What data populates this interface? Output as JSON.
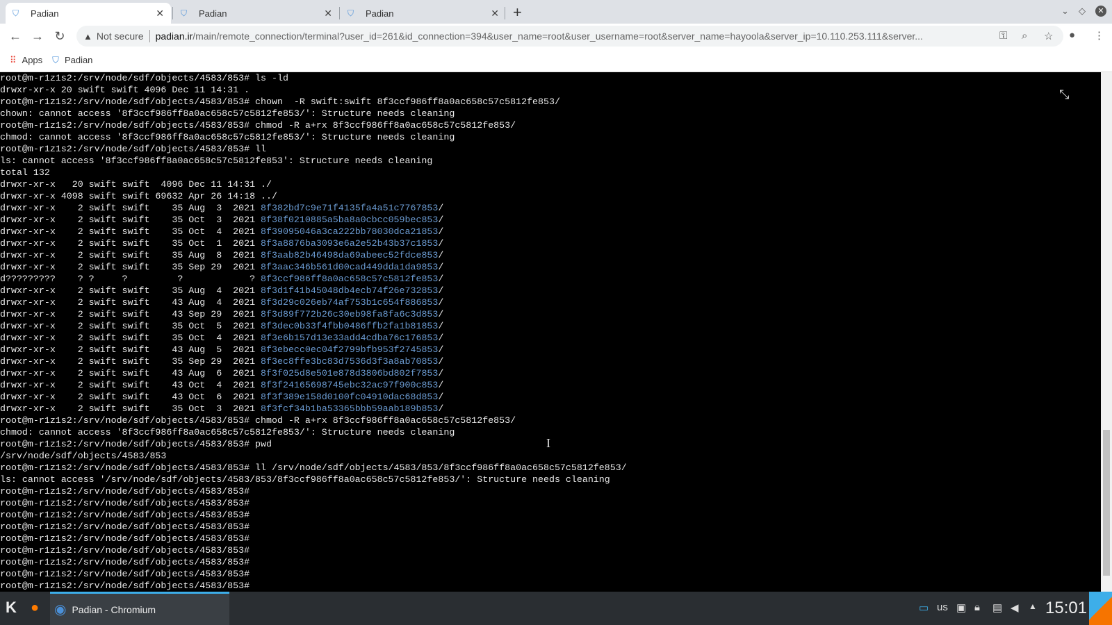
{
  "browser": {
    "tabs": [
      {
        "label": "Padian",
        "active": true
      },
      {
        "label": "Padian",
        "active": false
      },
      {
        "label": "Padian",
        "active": false
      }
    ],
    "security_label": "Not secure",
    "url_host": "padian.ir",
    "url_path": "/main/remote_connection/terminal?user_id=261&id_connection=394&user_name=root&user_username=root&server_name=hayoola&server_ip=10.110.253.111&server...",
    "bookmarks": [
      {
        "label": "Apps"
      },
      {
        "label": "Padian"
      }
    ]
  },
  "terminal": {
    "lines": [
      {
        "t": "root@m-r1z1s2:/srv/node/sdf/objects/4583/853# ls -ld"
      },
      {
        "t": "drwxr-xr-x 20 swift swift 4096 Dec 11 14:31 ."
      },
      {
        "t": "root@m-r1z1s2:/srv/node/sdf/objects/4583/853# chown  -R swift:swift 8f3ccf986ff8a0ac658c57c5812fe853/"
      },
      {
        "t": "chown: cannot access '8f3ccf986ff8a0ac658c57c5812fe853/': Structure needs cleaning"
      },
      {
        "t": "root@m-r1z1s2:/srv/node/sdf/objects/4583/853# chmod -R a+rx 8f3ccf986ff8a0ac658c57c5812fe853/"
      },
      {
        "t": "chmod: cannot access '8f3ccf986ff8a0ac658c57c5812fe853/': Structure needs cleaning"
      },
      {
        "t": "root@m-r1z1s2:/srv/node/sdf/objects/4583/853# ll"
      },
      {
        "t": "ls: cannot access '8f3ccf986ff8a0ac658c57c5812fe853': Structure needs cleaning"
      },
      {
        "t": "total 132"
      },
      {
        "t": "drwxr-xr-x   20 swift swift  4096 Dec 11 14:31 ./"
      },
      {
        "t": "drwxr-xr-x 4098 swift swift 69632 Apr 26 14:18 ../"
      },
      {
        "t": "drwxr-xr-x    2 swift swift    35 Aug  3  2021 ",
        "l": "8f382bd7c9e71f4135fa4a51c7767853"
      },
      {
        "t": "drwxr-xr-x    2 swift swift    35 Oct  3  2021 ",
        "l": "8f38f0210885a5ba8a0cbcc059bec853"
      },
      {
        "t": "drwxr-xr-x    2 swift swift    35 Oct  4  2021 ",
        "l": "8f39095046a3ca222bb78030dca21853"
      },
      {
        "t": "drwxr-xr-x    2 swift swift    35 Oct  1  2021 ",
        "l": "8f3a8876ba3093e6a2e52b43b37c1853"
      },
      {
        "t": "drwxr-xr-x    2 swift swift    35 Aug  8  2021 ",
        "l": "8f3aab82b46498da69abeec52fdce853"
      },
      {
        "t": "drwxr-xr-x    2 swift swift    35 Sep 29  2021 ",
        "l": "8f3aac346b561d00cad449dda1da9853"
      },
      {
        "t": "d?????????    ? ?     ?         ?            ? ",
        "l": "8f3ccf986ff8a0ac658c57c5812fe853"
      },
      {
        "t": "drwxr-xr-x    2 swift swift    35 Aug  4  2021 ",
        "l": "8f3d1f41b45048db4ecb74f26e732853"
      },
      {
        "t": "drwxr-xr-x    2 swift swift    43 Aug  4  2021 ",
        "l": "8f3d29c026eb74af753b1c654f886853"
      },
      {
        "t": "drwxr-xr-x    2 swift swift    43 Sep 29  2021 ",
        "l": "8f3d89f772b26c30eb98fa8fa6c3d853"
      },
      {
        "t": "drwxr-xr-x    2 swift swift    35 Oct  5  2021 ",
        "l": "8f3dec0b33f4fbb0486ffb2fa1b81853"
      },
      {
        "t": "drwxr-xr-x    2 swift swift    35 Oct  4  2021 ",
        "l": "8f3e6b157d13e33add4cdba76c176853"
      },
      {
        "t": "drwxr-xr-x    2 swift swift    43 Aug  5  2021 ",
        "l": "8f3ebecc0ec04f2799bfb953f2745853"
      },
      {
        "t": "drwxr-xr-x    2 swift swift    35 Sep 29  2021 ",
        "l": "8f3ec8ffe3bc83d7536d3f3a8ab70853"
      },
      {
        "t": "drwxr-xr-x    2 swift swift    43 Aug  6  2021 ",
        "l": "8f3f025d8e501e878d3806bd802f7853"
      },
      {
        "t": "drwxr-xr-x    2 swift swift    43 Oct  4  2021 ",
        "l": "8f3f24165698745ebc32ac97f900c853"
      },
      {
        "t": "drwxr-xr-x    2 swift swift    43 Oct  6  2021 ",
        "l": "8f3f389e158d0100fc04910dac68d853"
      },
      {
        "t": "drwxr-xr-x    2 swift swift    35 Oct  3  2021 ",
        "l": "8f3fcf34b1ba53365bbb59aab189b853"
      },
      {
        "t": "root@m-r1z1s2:/srv/node/sdf/objects/4583/853# chmod -R a+rx 8f3ccf986ff8a0ac658c57c5812fe853/"
      },
      {
        "t": "chmod: cannot access '8f3ccf986ff8a0ac658c57c5812fe853/': Structure needs cleaning"
      },
      {
        "t": "root@m-r1z1s2:/srv/node/sdf/objects/4583/853# pwd"
      },
      {
        "t": "/srv/node/sdf/objects/4583/853"
      },
      {
        "t": "root@m-r1z1s2:/srv/node/sdf/objects/4583/853# ll /srv/node/sdf/objects/4583/853/8f3ccf986ff8a0ac658c57c5812fe853/"
      },
      {
        "t": "ls: cannot access '/srv/node/sdf/objects/4583/853/8f3ccf986ff8a0ac658c57c5812fe853/': Structure needs cleaning"
      },
      {
        "t": "root@m-r1z1s2:/srv/node/sdf/objects/4583/853#"
      },
      {
        "t": "root@m-r1z1s2:/srv/node/sdf/objects/4583/853#"
      },
      {
        "t": "root@m-r1z1s2:/srv/node/sdf/objects/4583/853#"
      },
      {
        "t": "root@m-r1z1s2:/srv/node/sdf/objects/4583/853#"
      },
      {
        "t": "root@m-r1z1s2:/srv/node/sdf/objects/4583/853#"
      },
      {
        "t": "root@m-r1z1s2:/srv/node/sdf/objects/4583/853#"
      },
      {
        "t": "root@m-r1z1s2:/srv/node/sdf/objects/4583/853#"
      },
      {
        "t": "root@m-r1z1s2:/srv/node/sdf/objects/4583/853#"
      },
      {
        "t": "root@m-r1z1s2:/srv/node/sdf/objects/4583/853#"
      }
    ]
  },
  "taskbar": {
    "task_label": "Padian - Chromium",
    "keyboard_layout": "us",
    "clock": "15:01"
  }
}
